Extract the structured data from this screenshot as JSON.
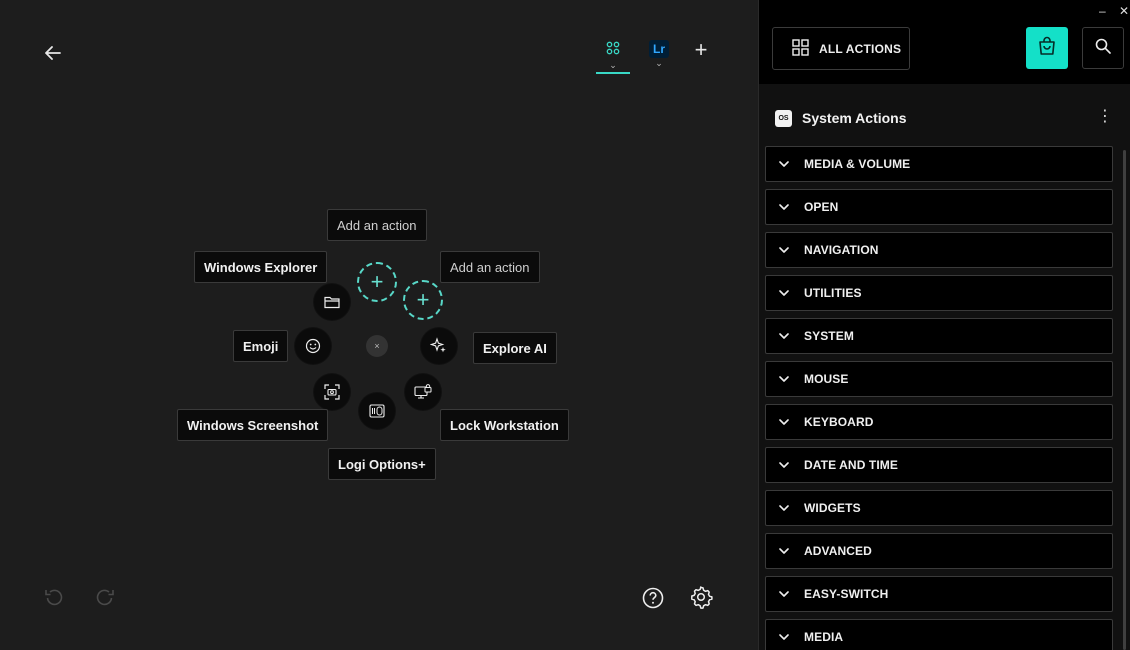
{
  "canvas": {
    "tabs": [
      {
        "name": "all-apps",
        "label": ""
      },
      {
        "name": "lightroom",
        "label": "Lr"
      }
    ],
    "radial": {
      "labels": {
        "add_top": "Add an action",
        "add_right": "Add an action",
        "windows_explorer": "Windows Explorer",
        "emoji": "Emoji",
        "explore_ai": "Explore AI",
        "windows_screenshot": "Windows Screenshot",
        "lock_workstation": "Lock Workstation",
        "logi_options": "Logi Options+"
      },
      "center_symbol": "×"
    }
  },
  "panel": {
    "all_actions_label": "ALL ACTIONS",
    "section": {
      "badge": "OS",
      "title": "System Actions"
    },
    "categories": [
      "MEDIA & VOLUME",
      "OPEN",
      "NAVIGATION",
      "UTILITIES",
      "SYSTEM",
      "MOUSE",
      "KEYBOARD",
      "DATE AND TIME",
      "WIDGETS",
      "ADVANCED",
      "EASY-SWITCH",
      "MEDIA"
    ],
    "window_controls": {
      "minimize": "–",
      "close": "✕"
    }
  },
  "colors": {
    "accent": "#14e0c8",
    "dashed": "#58d8c8",
    "background": "#1d1d1d",
    "panel": "#111111"
  }
}
